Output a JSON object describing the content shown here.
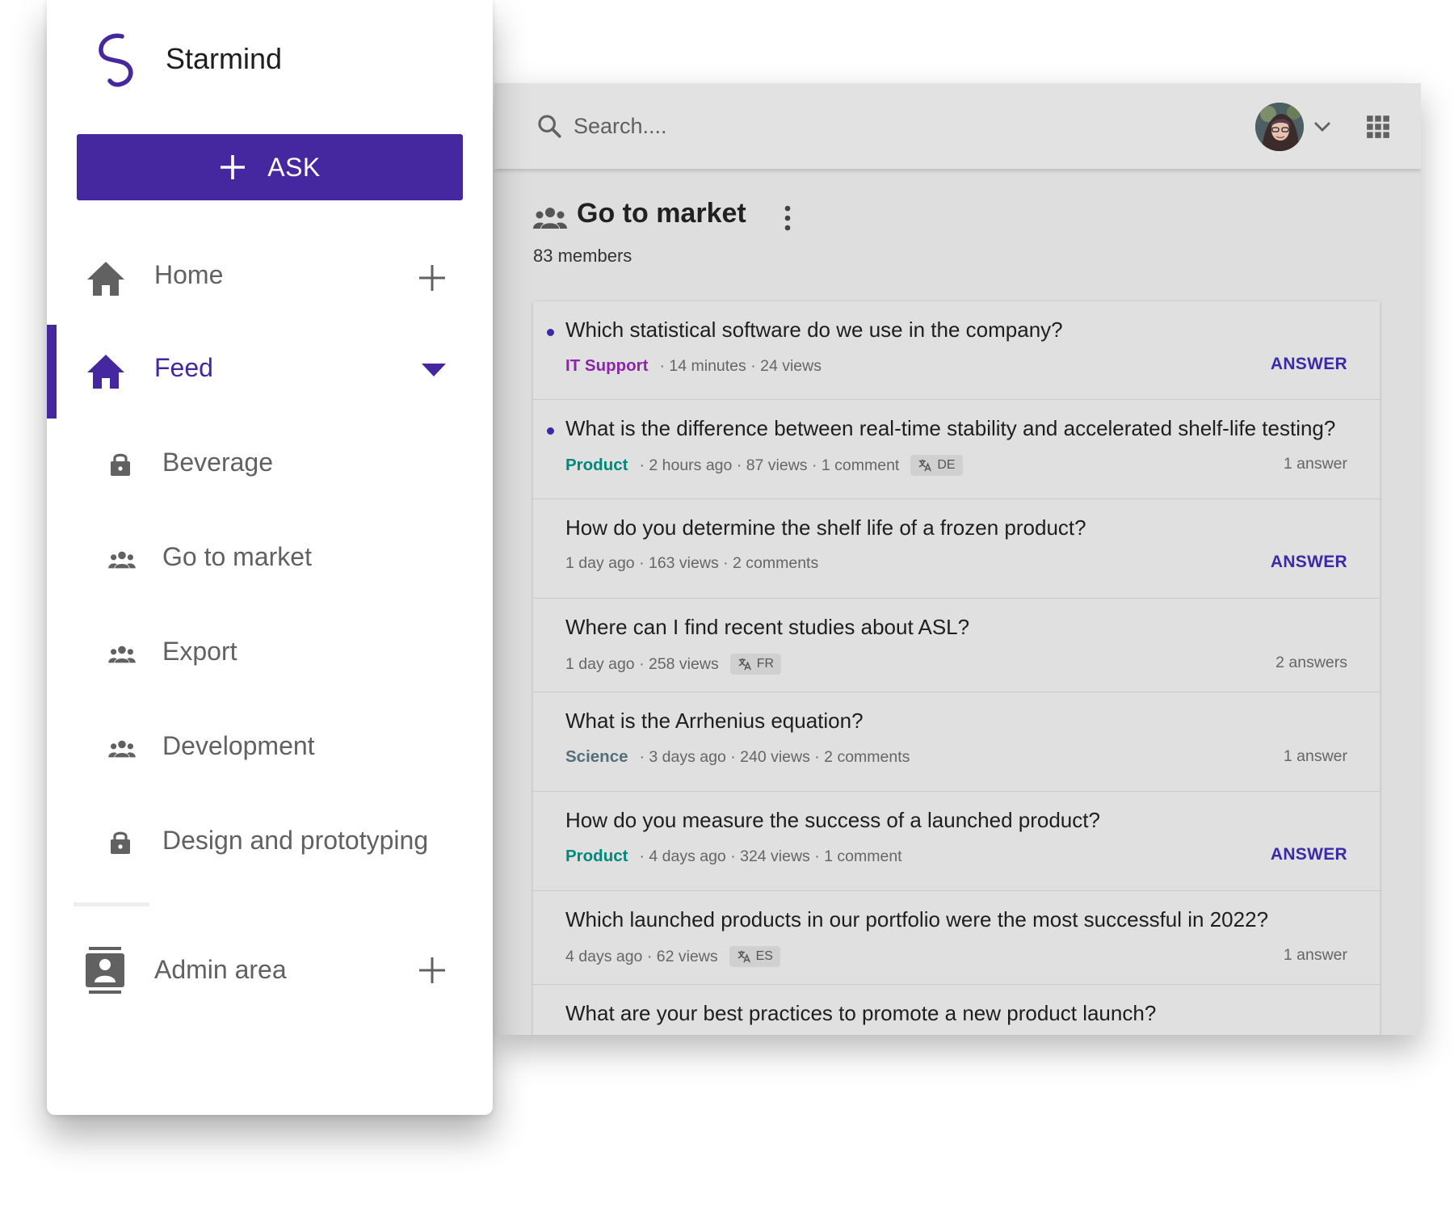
{
  "app": {
    "name": "Starmind"
  },
  "sidebar": {
    "ask_label": "ASK",
    "home_label": "Home",
    "feed_label": "Feed",
    "groups": [
      {
        "label": "Beverage",
        "icon": "lock-icon"
      },
      {
        "label": "Go to market",
        "icon": "group-icon"
      },
      {
        "label": "Export",
        "icon": "group-icon"
      },
      {
        "label": "Development",
        "icon": "group-icon"
      },
      {
        "label": "Design and prototyping",
        "icon": "lock-icon"
      }
    ],
    "admin_label": "Admin area"
  },
  "topbar": {
    "search_placeholder": "Search...."
  },
  "group": {
    "title": "Go to market",
    "members": "83 members"
  },
  "questions": [
    {
      "title": "Which statistical software do we use in the company?",
      "unread": true,
      "tag": "IT Support",
      "tag_color": "#8e24aa",
      "meta": "· 14 minutes · 24 views",
      "lang": "",
      "action": "ANSWER",
      "answers": ""
    },
    {
      "title": "What is the difference between real-time stability and accelerated shelf-life testing?",
      "unread": true,
      "tag": "Product",
      "tag_color": "#00897b",
      "meta": "· 2 hours ago · 87 views · 1 comment",
      "lang": "DE",
      "action": "",
      "answers": "1 answer"
    },
    {
      "title": "How do you determine the shelf life of a frozen product?",
      "unread": false,
      "tag": "",
      "tag_color": "",
      "meta": "1 day ago · 163 views · 2 comments",
      "lang": "",
      "action": "ANSWER",
      "answers": ""
    },
    {
      "title": "Where can I find recent studies about ASL?",
      "unread": false,
      "tag": "",
      "tag_color": "",
      "meta": "1 day ago · 258 views",
      "lang": "FR",
      "action": "",
      "answers": "2 answers"
    },
    {
      "title": "What is the Arrhenius equation?",
      "unread": false,
      "tag": "Science",
      "tag_color": "#546e7a",
      "meta": "· 3 days ago · 240 views · 2 comments",
      "lang": "",
      "action": "",
      "answers": "1 answer"
    },
    {
      "title": "How do you measure the success of a launched product?",
      "unread": false,
      "tag": "Product",
      "tag_color": "#00897b",
      "meta": "· 4 days ago · 324 views · 1 comment",
      "lang": "",
      "action": "ANSWER",
      "answers": ""
    },
    {
      "title": "Which launched products in our portfolio were the most successful in 2022?",
      "unread": false,
      "tag": "",
      "tag_color": "",
      "meta": "4 days ago · 62 views",
      "lang": "ES",
      "action": "",
      "answers": "1 answer"
    },
    {
      "title": "What are your best practices to promote a new product launch?",
      "unread": false,
      "tag": "",
      "tag_color": "",
      "meta": "",
      "lang": "",
      "action": "",
      "answers": ""
    }
  ],
  "colors": {
    "brand": "#4527a0",
    "answer_action": "#3a2aa8",
    "nav_icon": "#616161"
  }
}
